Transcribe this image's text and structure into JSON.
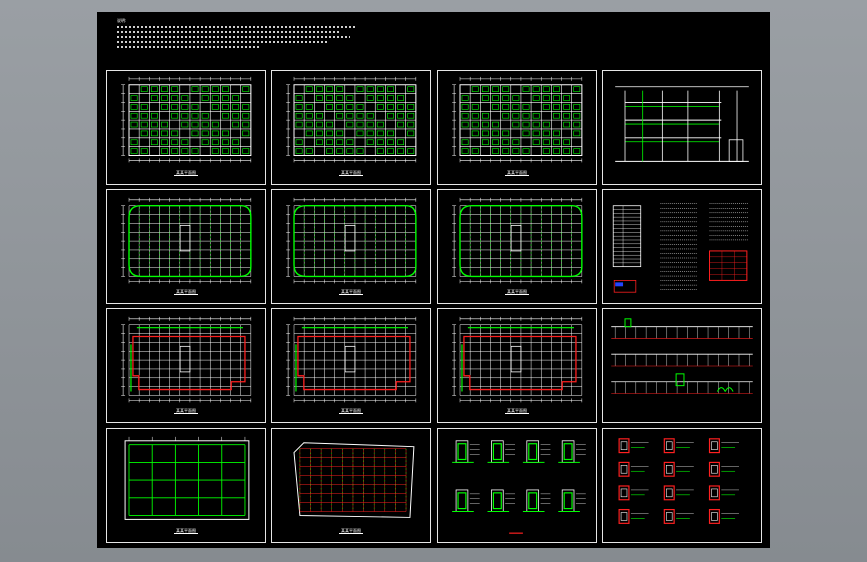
{
  "drawing": {
    "notes": {
      "heading": "说明:",
      "lines": 5
    },
    "panels": [
      {
        "id": "p1",
        "kind": "plan-dense",
        "caption": "某某平面图",
        "hasRed": false
      },
      {
        "id": "p2",
        "kind": "plan-dense",
        "caption": "某某平面图",
        "hasRed": false
      },
      {
        "id": "p3",
        "kind": "plan-dense",
        "caption": "某某平面图",
        "hasRed": false
      },
      {
        "id": "p4",
        "kind": "section",
        "caption": "",
        "hasRed": false
      },
      {
        "id": "p5",
        "kind": "plan-curved",
        "caption": "某某平面图",
        "hasRed": false
      },
      {
        "id": "p6",
        "kind": "plan-curved",
        "caption": "某某平面图",
        "hasRed": false
      },
      {
        "id": "p7",
        "kind": "plan-curved",
        "caption": "某某平面图",
        "hasRed": false
      },
      {
        "id": "p8",
        "kind": "schedule",
        "caption": "",
        "hasRed": true
      },
      {
        "id": "p9",
        "kind": "plan-red",
        "caption": "某某平面图",
        "hasRed": true
      },
      {
        "id": "p10",
        "kind": "plan-red",
        "caption": "某某平面图",
        "hasRed": true
      },
      {
        "id": "p11",
        "kind": "plan-red",
        "caption": "某某平面图",
        "hasRed": true
      },
      {
        "id": "p12",
        "kind": "elevation",
        "caption": "",
        "hasRed": false
      },
      {
        "id": "p13",
        "kind": "grid-open",
        "caption": "某某平面图",
        "hasRed": false
      },
      {
        "id": "p14",
        "kind": "plan-dotted",
        "caption": "某某平面图",
        "hasRed": true
      },
      {
        "id": "p15",
        "kind": "details-green",
        "caption": "",
        "hasRed": true
      },
      {
        "id": "p16",
        "kind": "details-red",
        "caption": "",
        "hasRed": true
      }
    ],
    "colors": {
      "line": "#ffffff",
      "green": "#00ff00",
      "red": "#ff2020",
      "background": "#000000",
      "frame": "#e6e6e6"
    }
  }
}
